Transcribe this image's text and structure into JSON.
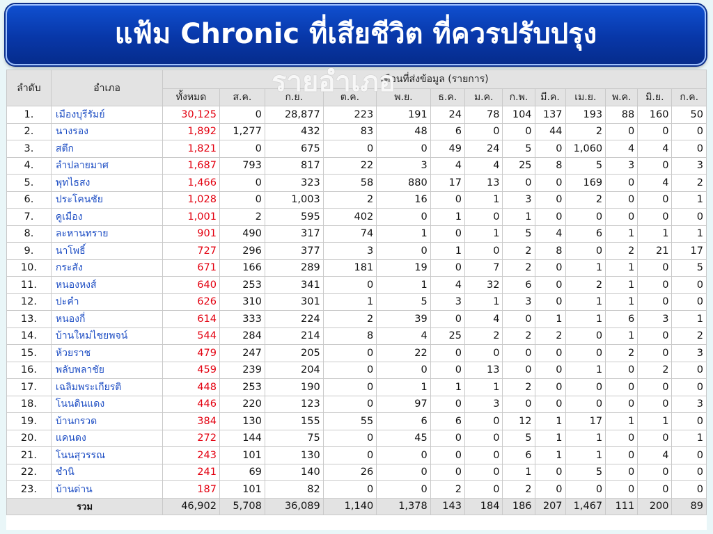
{
  "slide": {
    "title_line1": "แฟ้ม Chronic ที่เสียชีวิต ที่ควรปรับปรุง",
    "title_line2": "รายอำเภอ"
  },
  "table": {
    "header": {
      "rank": "ลำดับ",
      "district": "อำเภอ",
      "months_group": "เดือนที่ส่งข้อมูล (รายการ)",
      "total": "ทั้งหมด",
      "months": [
        "ส.ค.",
        "ก.ย.",
        "ต.ค.",
        "พ.ย.",
        "ธ.ค.",
        "ม.ค.",
        "ก.พ.",
        "มี.ค.",
        "เม.ย.",
        "พ.ค.",
        "มิ.ย.",
        "ก.ค."
      ]
    },
    "rows": [
      {
        "rank": "1.",
        "district": "เมืองบุรีรัมย์",
        "total": "30,125",
        "months": [
          "0",
          "28,877",
          "223",
          "191",
          "24",
          "78",
          "104",
          "137",
          "193",
          "88",
          "160",
          "50"
        ]
      },
      {
        "rank": "2.",
        "district": "นางรอง",
        "total": "1,892",
        "months": [
          "1,277",
          "432",
          "83",
          "48",
          "6",
          "0",
          "0",
          "44",
          "2",
          "0",
          "0",
          "0"
        ]
      },
      {
        "rank": "3.",
        "district": "สตึก",
        "total": "1,821",
        "months": [
          "0",
          "675",
          "0",
          "0",
          "49",
          "24",
          "5",
          "0",
          "1,060",
          "4",
          "4",
          "0"
        ]
      },
      {
        "rank": "4.",
        "district": "ลำปลายมาศ",
        "total": "1,687",
        "months": [
          "793",
          "817",
          "22",
          "3",
          "4",
          "4",
          "25",
          "8",
          "5",
          "3",
          "0",
          "3"
        ]
      },
      {
        "rank": "5.",
        "district": "พุทไธสง",
        "total": "1,466",
        "months": [
          "0",
          "323",
          "58",
          "880",
          "17",
          "13",
          "0",
          "0",
          "169",
          "0",
          "4",
          "2"
        ]
      },
      {
        "rank": "6.",
        "district": "ประโคนชัย",
        "total": "1,028",
        "months": [
          "0",
          "1,003",
          "2",
          "16",
          "0",
          "1",
          "3",
          "0",
          "2",
          "0",
          "0",
          "1"
        ]
      },
      {
        "rank": "7.",
        "district": "คูเมือง",
        "total": "1,001",
        "months": [
          "2",
          "595",
          "402",
          "0",
          "1",
          "0",
          "1",
          "0",
          "0",
          "0",
          "0",
          "0"
        ]
      },
      {
        "rank": "8.",
        "district": "ละหานทราย",
        "total": "901",
        "months": [
          "490",
          "317",
          "74",
          "1",
          "0",
          "1",
          "5",
          "4",
          "6",
          "1",
          "1",
          "1"
        ]
      },
      {
        "rank": "9.",
        "district": "นาโพธิ์",
        "total": "727",
        "months": [
          "296",
          "377",
          "3",
          "0",
          "1",
          "0",
          "2",
          "8",
          "0",
          "2",
          "21",
          "17"
        ]
      },
      {
        "rank": "10.",
        "district": "กระสัง",
        "total": "671",
        "months": [
          "166",
          "289",
          "181",
          "19",
          "0",
          "7",
          "2",
          "0",
          "1",
          "1",
          "0",
          "5"
        ]
      },
      {
        "rank": "11.",
        "district": "หนองหงส์",
        "total": "640",
        "months": [
          "253",
          "341",
          "0",
          "1",
          "4",
          "32",
          "6",
          "0",
          "2",
          "1",
          "0",
          "0"
        ]
      },
      {
        "rank": "12.",
        "district": "ปะคำ",
        "total": "626",
        "months": [
          "310",
          "301",
          "1",
          "5",
          "3",
          "1",
          "3",
          "0",
          "1",
          "1",
          "0",
          "0"
        ]
      },
      {
        "rank": "13.",
        "district": "หนองกี่",
        "total": "614",
        "months": [
          "333",
          "224",
          "2",
          "39",
          "0",
          "4",
          "0",
          "1",
          "1",
          "6",
          "3",
          "1"
        ]
      },
      {
        "rank": "14.",
        "district": "บ้านใหม่ไชยพจน์",
        "total": "544",
        "months": [
          "284",
          "214",
          "8",
          "4",
          "25",
          "2",
          "2",
          "2",
          "0",
          "1",
          "0",
          "2"
        ]
      },
      {
        "rank": "15.",
        "district": "ห้วยราช",
        "total": "479",
        "months": [
          "247",
          "205",
          "0",
          "22",
          "0",
          "0",
          "0",
          "0",
          "0",
          "2",
          "0",
          "3"
        ]
      },
      {
        "rank": "16.",
        "district": "พลับพลาชัย",
        "total": "459",
        "months": [
          "239",
          "204",
          "0",
          "0",
          "0",
          "13",
          "0",
          "0",
          "1",
          "0",
          "2",
          "0"
        ]
      },
      {
        "rank": "17.",
        "district": "เฉลิมพระเกียรติ",
        "total": "448",
        "months": [
          "253",
          "190",
          "0",
          "1",
          "1",
          "1",
          "2",
          "0",
          "0",
          "0",
          "0",
          "0"
        ]
      },
      {
        "rank": "18.",
        "district": "โนนดินแดง",
        "total": "446",
        "months": [
          "220",
          "123",
          "0",
          "97",
          "0",
          "3",
          "0",
          "0",
          "0",
          "0",
          "0",
          "3"
        ]
      },
      {
        "rank": "19.",
        "district": "บ้านกรวด",
        "total": "384",
        "months": [
          "130",
          "155",
          "55",
          "6",
          "6",
          "0",
          "12",
          "1",
          "17",
          "1",
          "1",
          "0"
        ]
      },
      {
        "rank": "20.",
        "district": "แคนดง",
        "total": "272",
        "months": [
          "144",
          "75",
          "0",
          "45",
          "0",
          "0",
          "5",
          "1",
          "1",
          "0",
          "0",
          "1"
        ]
      },
      {
        "rank": "21.",
        "district": "โนนสุวรรณ",
        "total": "243",
        "months": [
          "101",
          "130",
          "0",
          "0",
          "0",
          "0",
          "6",
          "1",
          "1",
          "0",
          "4",
          "0"
        ]
      },
      {
        "rank": "22.",
        "district": "ชำนิ",
        "total": "241",
        "months": [
          "69",
          "140",
          "26",
          "0",
          "0",
          "0",
          "1",
          "0",
          "5",
          "0",
          "0",
          "0"
        ]
      },
      {
        "rank": "23.",
        "district": "บ้านด่าน",
        "total": "187",
        "months": [
          "101",
          "82",
          "0",
          "0",
          "2",
          "0",
          "2",
          "0",
          "0",
          "0",
          "0",
          "0"
        ]
      }
    ],
    "summary": {
      "label": "รวม",
      "total": "46,902",
      "months": [
        "5,708",
        "36,089",
        "1,140",
        "1,378",
        "143",
        "184",
        "186",
        "207",
        "1,467",
        "111",
        "200",
        "89"
      ]
    }
  },
  "colors": {
    "title_background": "#0837a8",
    "total_text": "#e3000f",
    "district_text": "#1f4fc4",
    "header_background": "#e3e3e3"
  }
}
